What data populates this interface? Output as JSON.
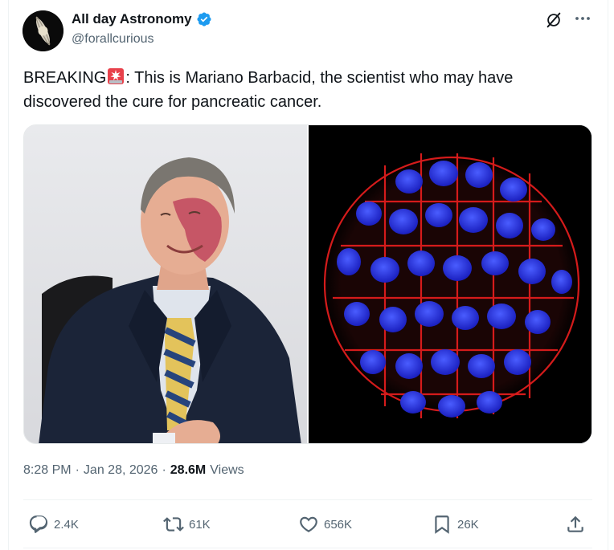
{
  "account": {
    "display_name": "All day Astronomy",
    "handle": "@forallcurious",
    "verified": true,
    "verified_color": "#1d9bf0"
  },
  "post": {
    "text_prefix": "BREAKING",
    "text_body": ": This is Mariano Barbacid, the scientist who may have discovered the cure for pancreatic cancer.",
    "emoji": "rotating-light-icon",
    "time": "8:28 PM",
    "separator": "·",
    "date": "Jan 28, 2026",
    "views_count": "28.6M",
    "views_label": "Views"
  },
  "actions": {
    "replies": "2.4K",
    "reposts": "61K",
    "likes": "656K",
    "bookmarks": "26K"
  },
  "icons": {
    "grok": "grok-icon",
    "more": "more-dots-icon",
    "reply": "reply-icon",
    "repost": "repost-icon",
    "like": "heart-icon",
    "bookmark": "bookmark-icon",
    "share": "share-icon"
  },
  "colors": {
    "text": "#0f1419",
    "secondary": "#536471",
    "accent": "#1d9bf0"
  }
}
